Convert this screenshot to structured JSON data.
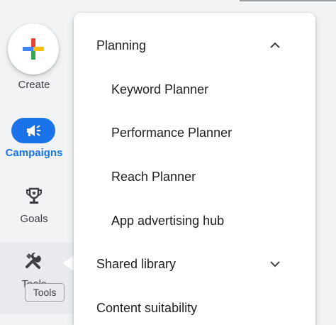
{
  "rail": {
    "create_label": "Create",
    "campaigns_label": "Campaigns",
    "goals_label": "Goals",
    "tools_label": "Tools",
    "tools_tooltip": "Tools"
  },
  "menu": {
    "planning": {
      "label": "Planning",
      "expanded": true,
      "items": [
        {
          "label": "Keyword Planner"
        },
        {
          "label": "Performance Planner"
        },
        {
          "label": "Reach Planner"
        },
        {
          "label": "App advertising hub"
        }
      ]
    },
    "shared_library": {
      "label": "Shared library",
      "expanded": false
    },
    "content_suitability": {
      "label": "Content suitability"
    }
  },
  "colors": {
    "accent": "#1a73e8",
    "rail_bg": "#f1f3f4",
    "plus": [
      "#4285f4",
      "#ea4335",
      "#fbbc04",
      "#34a853"
    ]
  },
  "icons": {
    "create": "google-plus-icon",
    "campaigns": "megaphone-icon",
    "goals": "trophy-icon",
    "tools": "wrench-icon",
    "collapse": "chevron-up-icon",
    "expand": "chevron-down-icon"
  }
}
